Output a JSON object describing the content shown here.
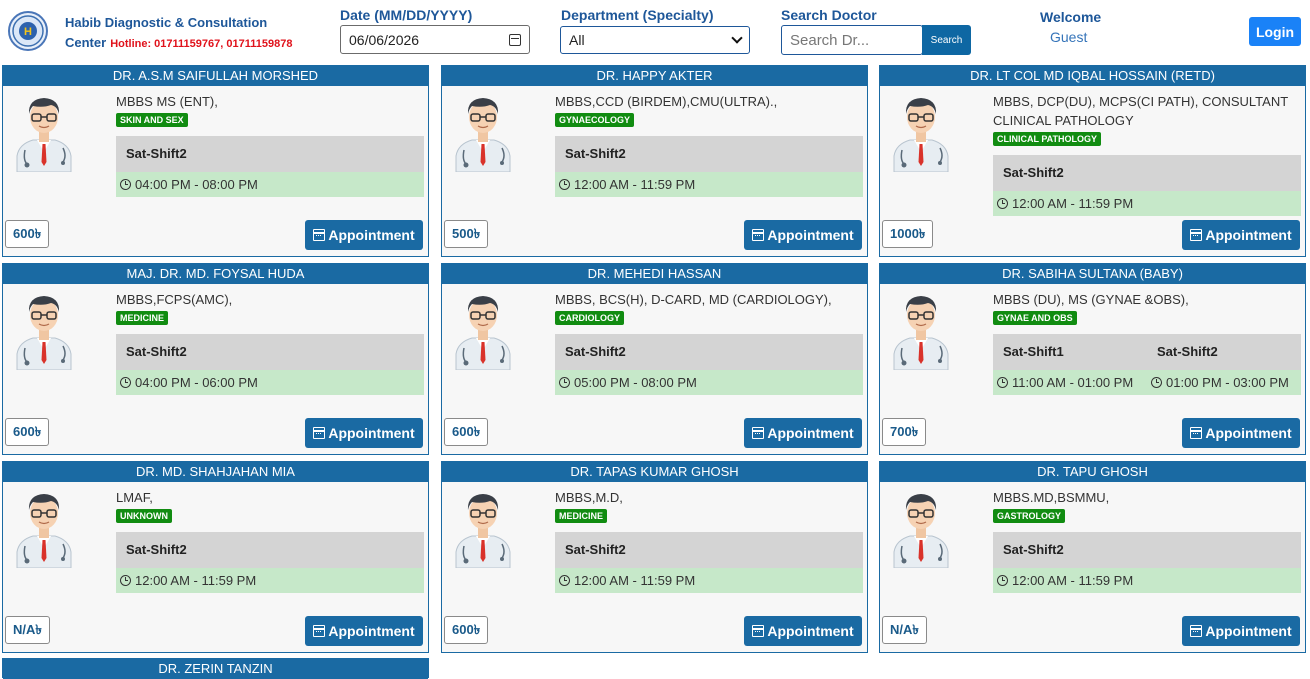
{
  "header": {
    "brand_name": "Habib Diagnostic & Consultation",
    "brand_center": "Center",
    "hotline": "Hotline: 01711159767, 01711159878",
    "date_label": "Date (MM/DD/YYYY)",
    "date_value": "06/06/2026",
    "dept_label": "Department (Specialty)",
    "dept_value": "All",
    "search_label": "Search Doctor",
    "search_placeholder": "Search Dr...",
    "search_button": "Search",
    "welcome": "Welcome",
    "guest": "Guest",
    "login": "Login"
  },
  "appointment_label": "Appointment",
  "doctors": [
    {
      "name": "DR. A.S.M SAIFULLAH MORSHED",
      "degree": "MBBS MS (ENT),",
      "specialty": "SKIN AND SEX",
      "fee": "600৳",
      "shifts": [
        {
          "name": "Sat-Shift2",
          "time": "04:00 PM - 08:00 PM"
        }
      ]
    },
    {
      "name": "DR. HAPPY AKTER",
      "degree": "MBBS,CCD (BIRDEM),CMU(ULTRA).,",
      "specialty": "GYNAECOLOGY",
      "fee": "500৳",
      "shifts": [
        {
          "name": "Sat-Shift2",
          "time": "12:00 AM - 11:59 PM"
        }
      ]
    },
    {
      "name": "DR. LT COL MD IQBAL HOSSAIN (RETD)",
      "degree": "MBBS, DCP(DU), MCPS(CI PATH), CONSULTANT CLINICAL PATHOLOGY",
      "specialty": "CLINICAL PATHOLOGY",
      "fee": "1000৳",
      "shifts": [
        {
          "name": "Sat-Shift2",
          "time": "12:00 AM - 11:59 PM"
        }
      ]
    },
    {
      "name": "MAJ. DR. MD. FOYSAL HUDA",
      "degree": "MBBS,FCPS(AMC),",
      "specialty": "MEDICINE",
      "fee": "600৳",
      "shifts": [
        {
          "name": "Sat-Shift2",
          "time": "04:00 PM - 06:00 PM"
        }
      ]
    },
    {
      "name": "DR. MEHEDI HASSAN",
      "degree": "MBBS, BCS(H), D-CARD, MD (CARDIOLOGY),",
      "specialty": "CARDIOLOGY",
      "fee": "600৳",
      "shifts": [
        {
          "name": "Sat-Shift2",
          "time": "05:00 PM - 08:00 PM"
        }
      ]
    },
    {
      "name": "DR. SABIHA SULTANA (BABY)",
      "degree": "MBBS (DU), MS (GYNAE &OBS),",
      "specialty": "GYNAE AND OBS",
      "fee": "700৳",
      "shifts": [
        {
          "name": "Sat-Shift1",
          "time": "11:00 AM - 01:00 PM"
        },
        {
          "name": "Sat-Shift2",
          "time": "01:00 PM - 03:00 PM"
        }
      ]
    },
    {
      "name": "DR. MD. SHAHJAHAN MIA",
      "degree": "LMAF,",
      "specialty": "UNKNOWN",
      "fee": "N/A৳",
      "shifts": [
        {
          "name": "Sat-Shift2",
          "time": "12:00 AM - 11:59 PM"
        }
      ]
    },
    {
      "name": "DR. TAPAS KUMAR GHOSH",
      "degree": "MBBS,M.D,",
      "specialty": "MEDICINE",
      "fee": "600৳",
      "shifts": [
        {
          "name": "Sat-Shift2",
          "time": "12:00 AM - 11:59 PM"
        }
      ]
    },
    {
      "name": "DR. TAPU GHOSH",
      "degree": "MBBS.MD,BSMMU,",
      "specialty": "GASTROLOGY",
      "fee": "N/A৳",
      "shifts": [
        {
          "name": "Sat-Shift2",
          "time": "12:00 AM - 11:59 PM"
        }
      ]
    }
  ],
  "partial_doctor_name": "DR. ZERIN TANZIN"
}
